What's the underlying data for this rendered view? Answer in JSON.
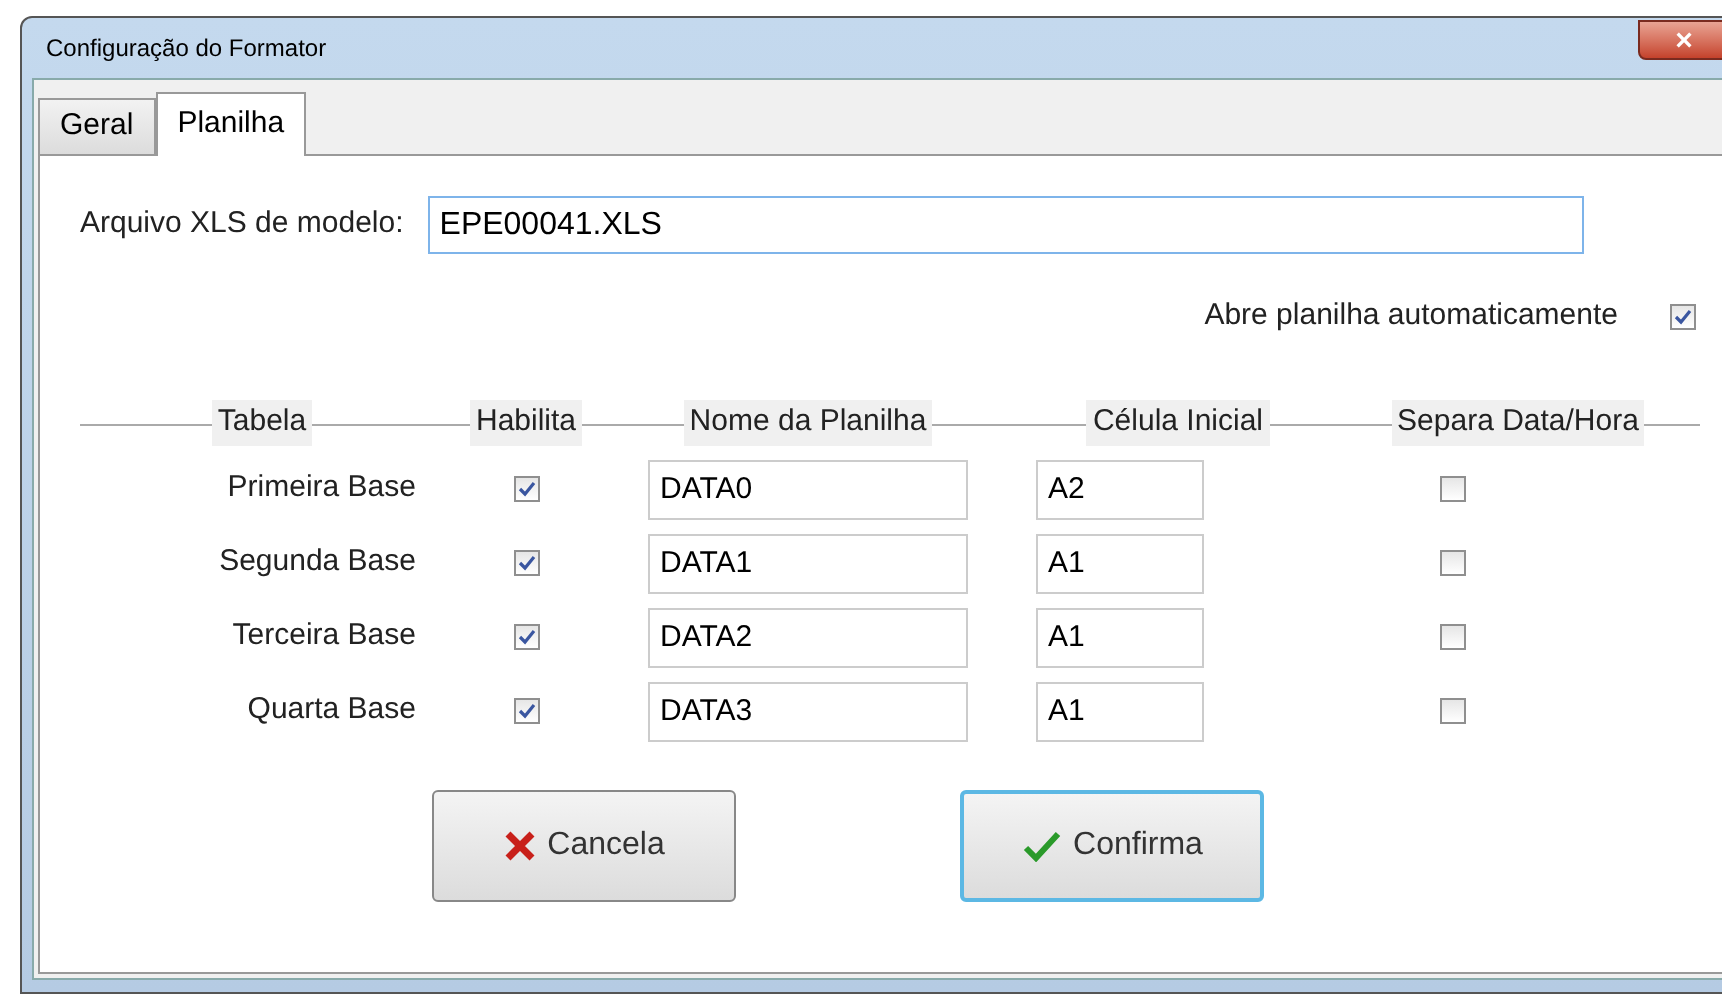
{
  "window": {
    "title": "Configuração do Formator",
    "close": "×"
  },
  "tabs": [
    {
      "label": "Geral",
      "selected": false
    },
    {
      "label": "Planilha",
      "selected": true
    }
  ],
  "model_file": {
    "label": "Arquivo XLS de modelo:",
    "value": "EPE00041.XLS"
  },
  "auto_open": {
    "label": "Abre planilha automaticamente",
    "checked": true
  },
  "table": {
    "columns": [
      "Tabela",
      "Habilita",
      "Nome da Planilha",
      "Célula Inicial",
      "Separa Data/Hora"
    ],
    "rows": [
      {
        "name": "Primeira Base",
        "enabled": true,
        "sheet": "DATA0",
        "cell": "A2",
        "split": false
      },
      {
        "name": "Segunda Base",
        "enabled": true,
        "sheet": "DATA1",
        "cell": "A1",
        "split": false
      },
      {
        "name": "Terceira Base",
        "enabled": true,
        "sheet": "DATA2",
        "cell": "A1",
        "split": false
      },
      {
        "name": "Quarta Base",
        "enabled": true,
        "sheet": "DATA3",
        "cell": "A1",
        "split": false
      }
    ]
  },
  "buttons": [
    {
      "kind": "cancel",
      "label": "Cancela",
      "focused": false
    },
    {
      "kind": "confirm",
      "label": "Confirma",
      "focused": true
    }
  ]
}
